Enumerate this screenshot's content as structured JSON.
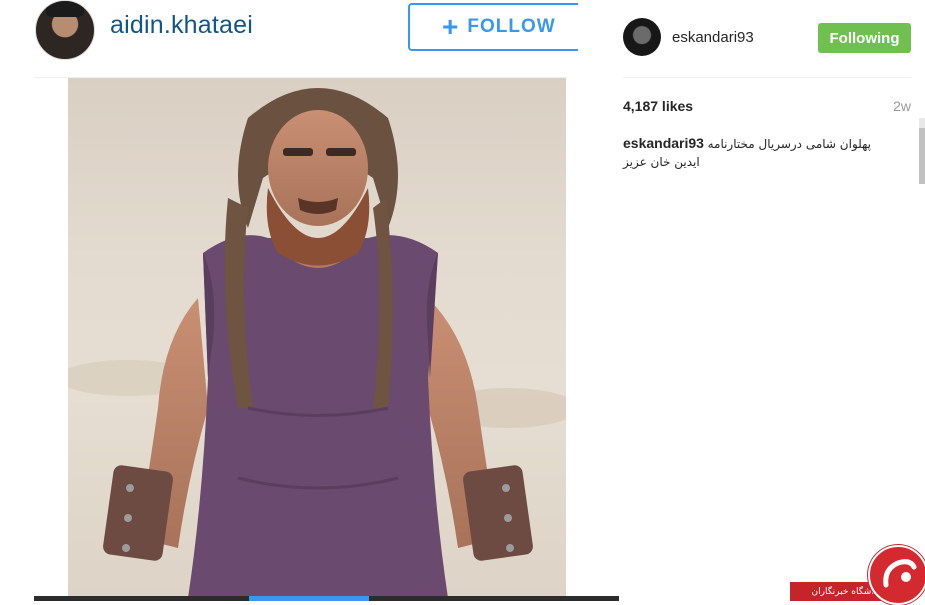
{
  "profile": {
    "username": "aidin.khataei",
    "follow_label": "FOLLOW",
    "follow_plus": "+"
  },
  "post": {
    "author": "eskandari93",
    "following_label": "Following",
    "likes": "4,187 likes",
    "time": "2w",
    "caption_user": "eskandari93",
    "caption_text": "پهلوان شامی درسریال مختارنامه ایدین خان عزیز"
  },
  "watermark": {
    "text": "باشگاه خبرنگاران"
  },
  "colors": {
    "username_blue": "#125688",
    "follow_blue": "#3897f0",
    "following_green": "#70c050",
    "watermark_red": "#c5252a"
  },
  "icons": {
    "follow": "plus-icon",
    "watermark_logo": "yjc-logo-icon"
  }
}
